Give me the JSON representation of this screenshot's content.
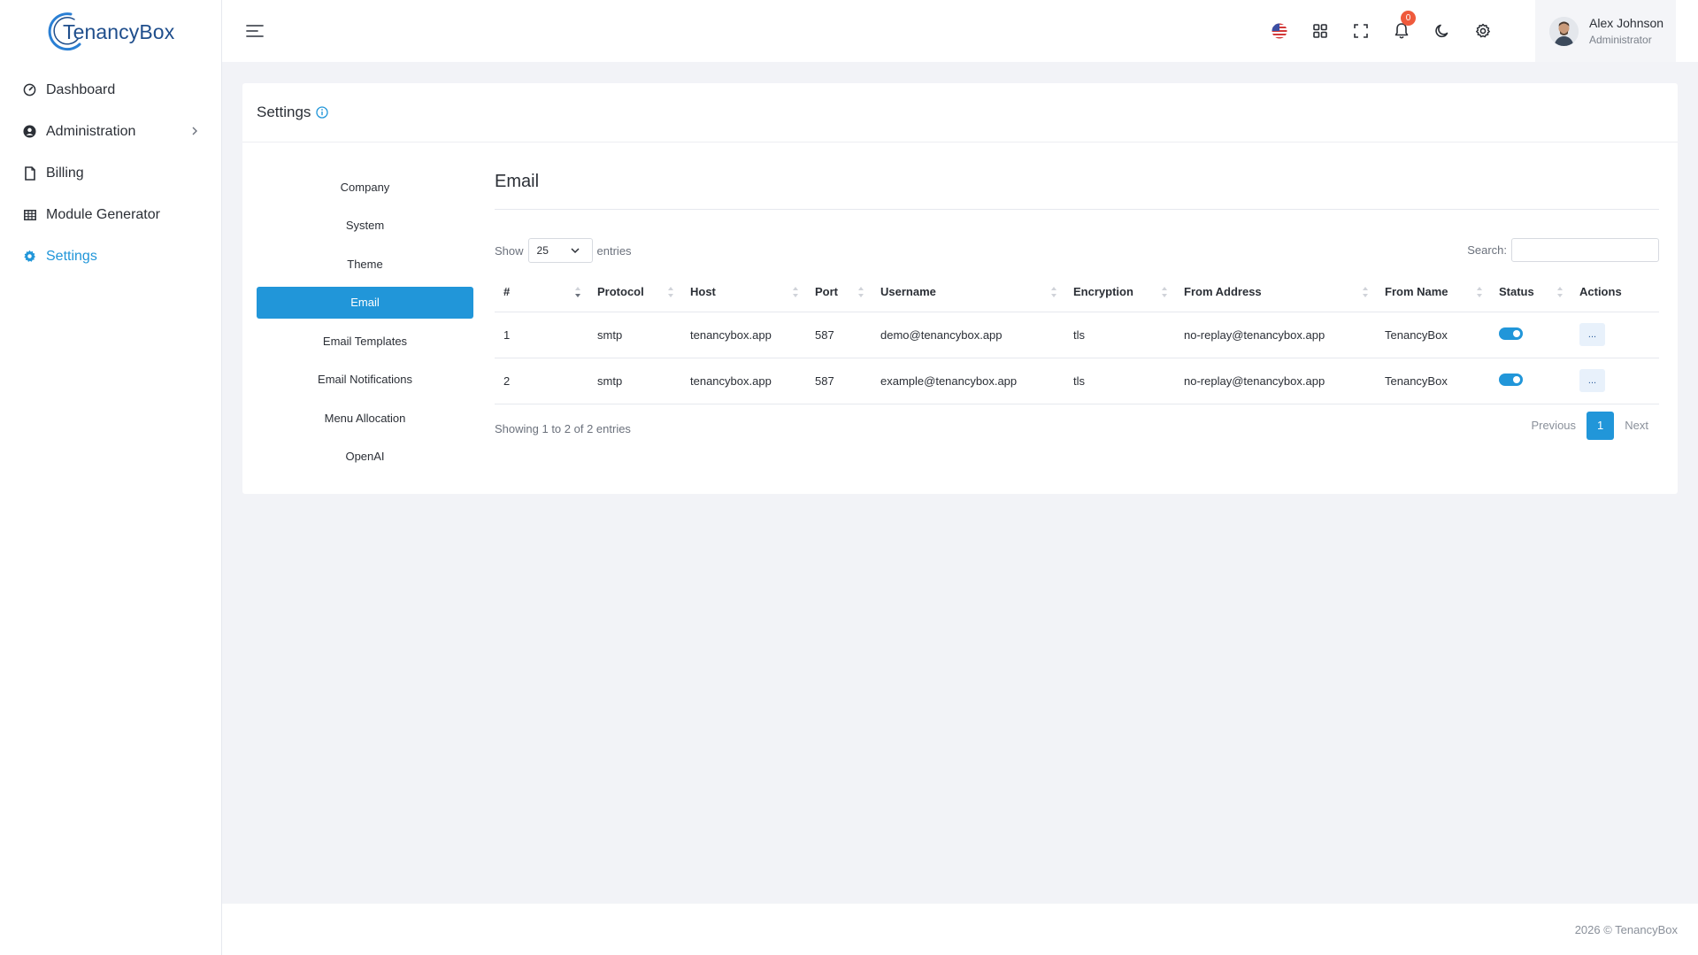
{
  "brand": {
    "name": "TenancyBox"
  },
  "sidebar": {
    "items": [
      {
        "label": "Dashboard",
        "icon": "gauge-icon",
        "active": false
      },
      {
        "label": "Administration",
        "icon": "user-circle-icon",
        "active": false,
        "has_children": true
      },
      {
        "label": "Billing",
        "icon": "file-icon",
        "active": false
      },
      {
        "label": "Module Generator",
        "icon": "grid-table-icon",
        "active": false
      },
      {
        "label": "Settings",
        "icon": "gear-icon",
        "active": true
      }
    ]
  },
  "topbar": {
    "notifications_count": "0",
    "user": {
      "name": "Alex Johnson",
      "role": "Administrator"
    }
  },
  "card": {
    "title": "Settings",
    "menu": [
      {
        "label": "Company",
        "active": false
      },
      {
        "label": "System",
        "active": false
      },
      {
        "label": "Theme",
        "active": false
      },
      {
        "label": "Email",
        "active": true
      },
      {
        "label": "Email Templates",
        "active": false
      },
      {
        "label": "Email Notifications",
        "active": false
      },
      {
        "label": "Menu Allocation",
        "active": false
      },
      {
        "label": "OpenAI",
        "active": false
      }
    ],
    "section_title": "Email",
    "show_label": "Show",
    "entries_value": "25",
    "entries_label": "entries",
    "search_label": "Search:",
    "columns": [
      "#",
      "Protocol",
      "Host",
      "Port",
      "Username",
      "Encryption",
      "From Address",
      "From Name",
      "Status",
      "Actions"
    ],
    "rows": [
      {
        "num": "1",
        "protocol": "smtp",
        "host": "tenancybox.app",
        "port": "587",
        "username": "demo@tenancybox.app",
        "encryption": "tls",
        "from_address": "no-replay@tenancybox.app",
        "from_name": "TenancyBox",
        "status": true,
        "action": "..."
      },
      {
        "num": "2",
        "protocol": "smtp",
        "host": "tenancybox.app",
        "port": "587",
        "username": "example@tenancybox.app",
        "encryption": "tls",
        "from_address": "no-replay@tenancybox.app",
        "from_name": "TenancyBox",
        "status": true,
        "action": "..."
      }
    ],
    "info_text": "Showing 1 to 2 of 2 entries",
    "pagination": {
      "previous": "Previous",
      "current": "1",
      "next": "Next"
    }
  },
  "footer": {
    "text": "2026 © TenancyBox"
  },
  "colors": {
    "accent": "#2196d9",
    "badge": "#ef5a3c"
  }
}
